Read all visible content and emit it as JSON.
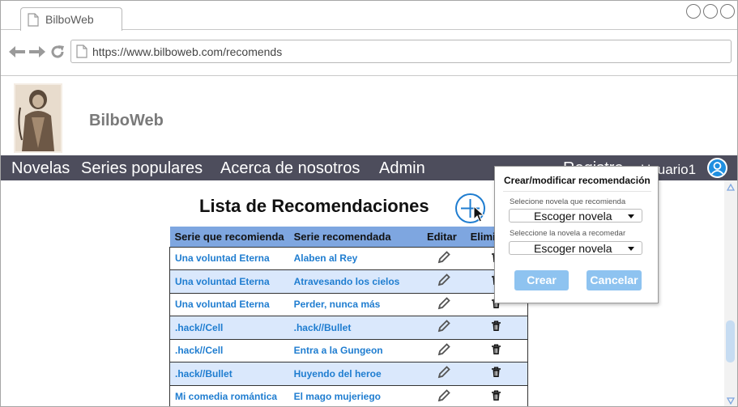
{
  "browser": {
    "tab_title": "BilboWeb",
    "url": "https://www.bilboweb.com/recomends"
  },
  "site": {
    "name": "BilboWeb",
    "nav": [
      "Novelas",
      "Series populares",
      "Acerca de nosotros",
      "Admin"
    ],
    "register_label": "Registro",
    "user_label": "Usuario1"
  },
  "main": {
    "title": "Lista de Recomendaciones",
    "table": {
      "headers": [
        "Serie que recomienda",
        "Serie recomendada",
        "Editar",
        "Eliminar"
      ],
      "rows": [
        [
          "Una voluntad Eterna",
          "Alaben al Rey"
        ],
        [
          "Una voluntad Eterna",
          "Atravesando los cielos"
        ],
        [
          "Una voluntad Eterna",
          "Perder, nunca más"
        ],
        [
          ".hack//Cell",
          ".hack//Bullet"
        ],
        [
          ".hack//Cell",
          "Entra a la Gungeon"
        ],
        [
          ".hack//Bullet",
          "Huyendo del heroe"
        ],
        [
          "Mi comedia romántica",
          "El mago mujeriego"
        ]
      ]
    }
  },
  "popup": {
    "title": "Crear/modificar recomendación",
    "field1_label": "Selecione novela que recomienda",
    "field1_value": "Escoger novela",
    "field2_label": "Seleccione la novela a recomedar",
    "field2_value": "Escoger novela",
    "create_label": "Crear",
    "cancel_label": "Cancelar"
  },
  "colors": {
    "nav_bg": "#4d4d5c",
    "header_row": "#7ea6e0",
    "alt_row": "#dae8fc",
    "link": "#1f7dd0",
    "button": "#8ec3f0"
  }
}
